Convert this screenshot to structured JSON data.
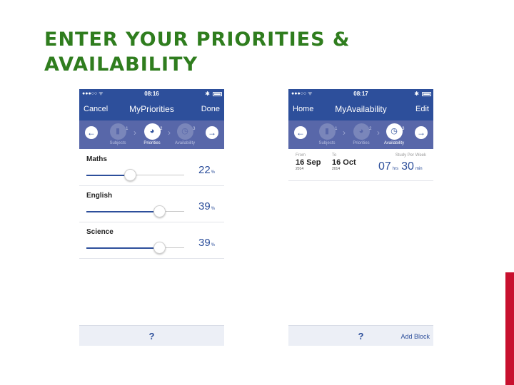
{
  "slide": {
    "title": "ENTER YOUR PRIORITIES &\nAVAILABILITY",
    "accent_color": "#2f7d1e"
  },
  "phones": {
    "status_left": "●●●○○ ᯤ",
    "battery_icon": "bluetooth-icon",
    "bluetooth": "✱"
  },
  "priorities": {
    "status_time": "08:16",
    "nav_left": "Cancel",
    "nav_title": "MyPriorities",
    "nav_right": "Done",
    "steps": [
      {
        "num": "1",
        "label": "Subjects",
        "icon": "bar-chart-icon"
      },
      {
        "num": "2",
        "label": "Priorities",
        "icon": "pie-chart-icon"
      },
      {
        "num": "3",
        "label": "Availability",
        "icon": "clock-icon"
      }
    ],
    "subjects": [
      {
        "name": "Maths",
        "percent": "22",
        "unit": "%",
        "value": 0.22
      },
      {
        "name": "English",
        "percent": "39",
        "unit": "%",
        "value": 0.39
      },
      {
        "name": "Science",
        "percent": "39",
        "unit": "%",
        "value": 0.39
      }
    ],
    "help": "?"
  },
  "availability": {
    "status_time": "08:17",
    "nav_left": "Home",
    "nav_title": "MyAvailability",
    "nav_right": "Edit",
    "steps": [
      {
        "num": "1",
        "label": "Subjects",
        "icon": "bar-chart-icon"
      },
      {
        "num": "2",
        "label": "Priorities",
        "icon": "pie-chart-icon"
      },
      {
        "num": "3",
        "label": "Availability",
        "icon": "clock-icon"
      }
    ],
    "from_label": "From",
    "from_date": "16 Sep",
    "from_year": "2014",
    "to_label": "To",
    "to_date": "16 Oct",
    "to_year": "2014",
    "study_label": "Study Per Week",
    "hours": "07",
    "hours_unit": "hrs",
    "minutes": "30",
    "minutes_unit": "min",
    "help": "?",
    "add_block": "Add Block"
  }
}
